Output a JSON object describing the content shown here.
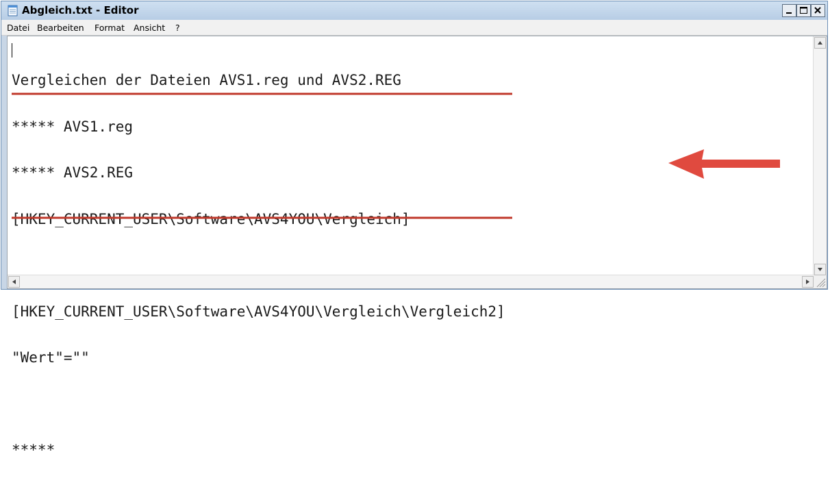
{
  "window": {
    "title": "Abgleich.txt - Editor"
  },
  "menu": [
    "Datei",
    "Bearbeiten",
    "Format",
    "Ansicht",
    "?"
  ],
  "lines": [
    "Vergleichen der Dateien AVS1.reg und AVS2.REG",
    "***** AVS1.reg",
    "***** AVS2.REG",
    "[HKEY_CURRENT_USER\\Software\\AVS4YOU\\Vergleich]",
    "",
    "[HKEY_CURRENT_USER\\Software\\AVS4YOU\\Vergleich\\Vergleich2]",
    "\"Wert\"=\"\"",
    "",
    "*****"
  ],
  "colors": {
    "annotation_underline": "#c0392b",
    "annotation_arrow": "#e04a3f"
  },
  "icons": [
    "notepad-icon",
    "minimize-icon",
    "maximize-icon",
    "close-icon",
    "scroll-up-icon",
    "scroll-down-icon",
    "scroll-left-icon",
    "scroll-right-icon",
    "resize-grip-icon",
    "arrow-left-icon"
  ]
}
